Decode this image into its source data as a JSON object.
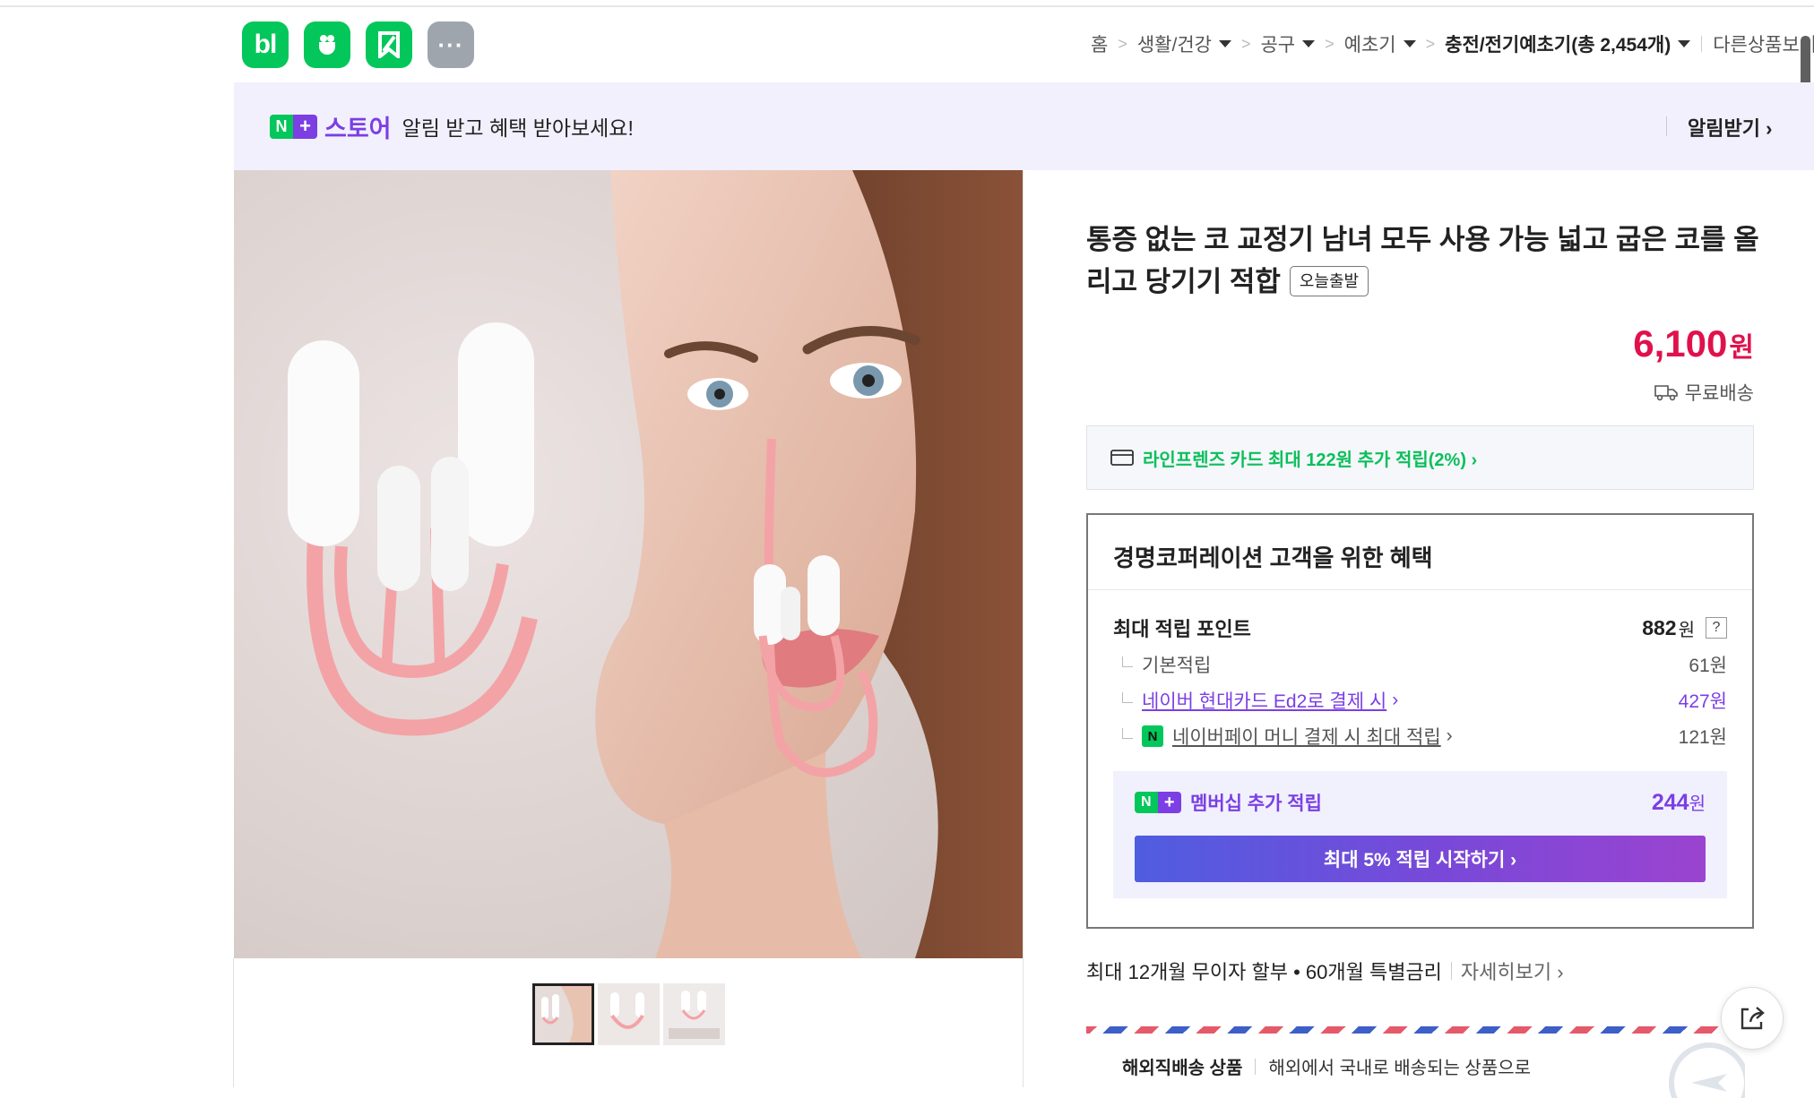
{
  "top_services": [
    {
      "name": "blog",
      "label": "bl",
      "color": "#03c75a"
    },
    {
      "name": "cafe",
      "color": "#03c75a"
    },
    {
      "name": "bookmark",
      "color": "#03c75a"
    },
    {
      "name": "more",
      "label": "···",
      "color": "#9ea5ad"
    }
  ],
  "breadcrumb": {
    "home": "홈",
    "cat1": "생활/건강",
    "cat2": "공구",
    "cat3": "예초기",
    "cat4": "충전/전기예초기(총 2,454개)",
    "other": "다른상품보기"
  },
  "banner": {
    "n_label": "N",
    "plus_label": "+",
    "store": "스토어",
    "message": "알림 받고 혜택 받아보세요!",
    "action": "알림받기 ›"
  },
  "product": {
    "title": "통증 없는 코 교정기 남녀 모두 사용 가능 넓고 굽은 코를 올리고 당기기 적합",
    "tag": "오늘출발",
    "price": "6,100",
    "currency": "원",
    "shipping": "무료배송"
  },
  "card_promo": "라인프렌즈 카드 최대 122원 추가 적립(2%) ›",
  "benefit": {
    "heading": "경명코퍼레이션 고객을 위한 혜택",
    "max_points_label": "최대 적립 포인트",
    "max_points_value": "882",
    "unit": "원",
    "help": "?",
    "rows": [
      {
        "label": "기본적립",
        "value": "61원"
      },
      {
        "label": "네이버 현대카드 Ed2로 결제 시",
        "value": "427원"
      },
      {
        "label": "네이버페이 머니 결제 시 최대 적립",
        "value": "121원"
      }
    ],
    "npay_badge": "N",
    "membership_label": "멤버십 추가 적립",
    "membership_value": "244",
    "membership_button": "최대 5% 적립 시작하기 ›"
  },
  "installment": {
    "text": "최대 12개월 무이자 할부 • 60개월 특별금리",
    "more": "자세히보기 ›"
  },
  "overseas": {
    "label": "해외직배송 상품",
    "desc": "해외에서 국내로 배송되는 상품으로"
  },
  "colors": {
    "naver_green": "#03c75a",
    "naver_purple": "#7b3fe4",
    "price_red": "#e0114c"
  },
  "icons": [
    "truck-icon",
    "card-icon",
    "share-icon",
    "caret-down-icon"
  ]
}
